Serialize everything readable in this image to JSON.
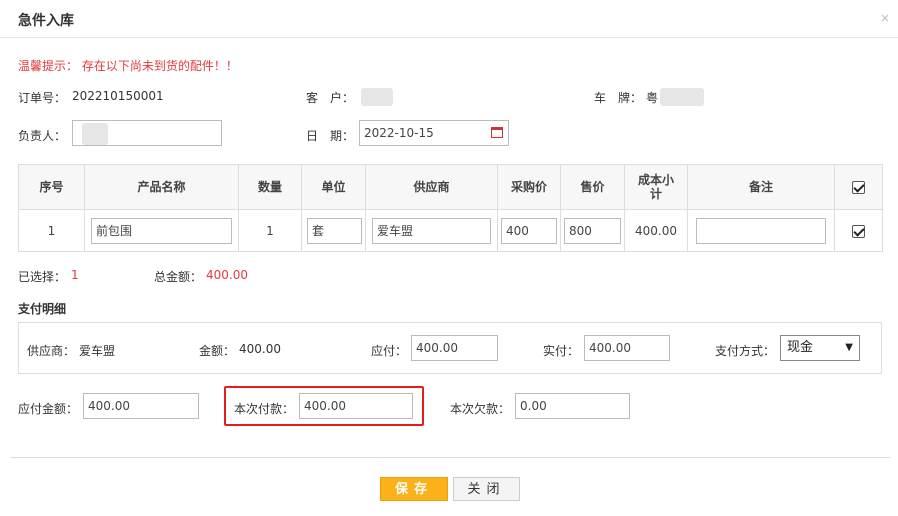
{
  "dialog": {
    "title": "急件入库",
    "close_icon": "×"
  },
  "tip": "温馨提示： 存在以下尚未到货的配件！！",
  "order": {
    "order_no_label": "订单号：",
    "order_no": "202210150001",
    "customer_label": "客　户：",
    "customer_value": "",
    "plate_label": "车　牌：",
    "plate_value": "粤",
    "person_label": "负责人：",
    "person_value": "",
    "date_label": "日　期：",
    "date_value": "2022-10-15"
  },
  "table": {
    "headers": [
      "序号",
      "产品名称",
      "数量",
      "单位",
      "供应商",
      "采购价",
      "售价",
      "成本小计",
      "备注"
    ],
    "rows": [
      {
        "index": "1",
        "product": "前包围",
        "qty": "1",
        "unit": "套",
        "supplier": "爱车盟",
        "purchase_price": "400",
        "sale_price": "800",
        "cost_subtotal": "400.00",
        "note": ""
      }
    ]
  },
  "summary": {
    "selected_label": "已选择：",
    "selected_value": "1",
    "total_label": "总金额：",
    "total_value": "400.00"
  },
  "payment": {
    "section_title": "支付明细",
    "supplier_label": "供应商：",
    "supplier_value": "爱车盟",
    "amount_label": "金额：",
    "amount_value": "400.00",
    "payable_label": "应付：",
    "payable_value": "400.00",
    "paid_label": "实付：",
    "paid_value": "400.00",
    "method_label": "支付方式：",
    "method_value": "现金"
  },
  "totals": {
    "payable_total_label": "应付金额：",
    "payable_total_value": "400.00",
    "this_pay_label": "本次付款：",
    "this_pay_value": "400.00",
    "this_debt_label": "本次欠款：",
    "this_debt_value": "0.00"
  },
  "buttons": {
    "save": "保存",
    "close": "关闭"
  },
  "colors": {
    "accent": "#fbb11a",
    "warning_red": "#e4393c",
    "highlight_border": "#e02020"
  }
}
